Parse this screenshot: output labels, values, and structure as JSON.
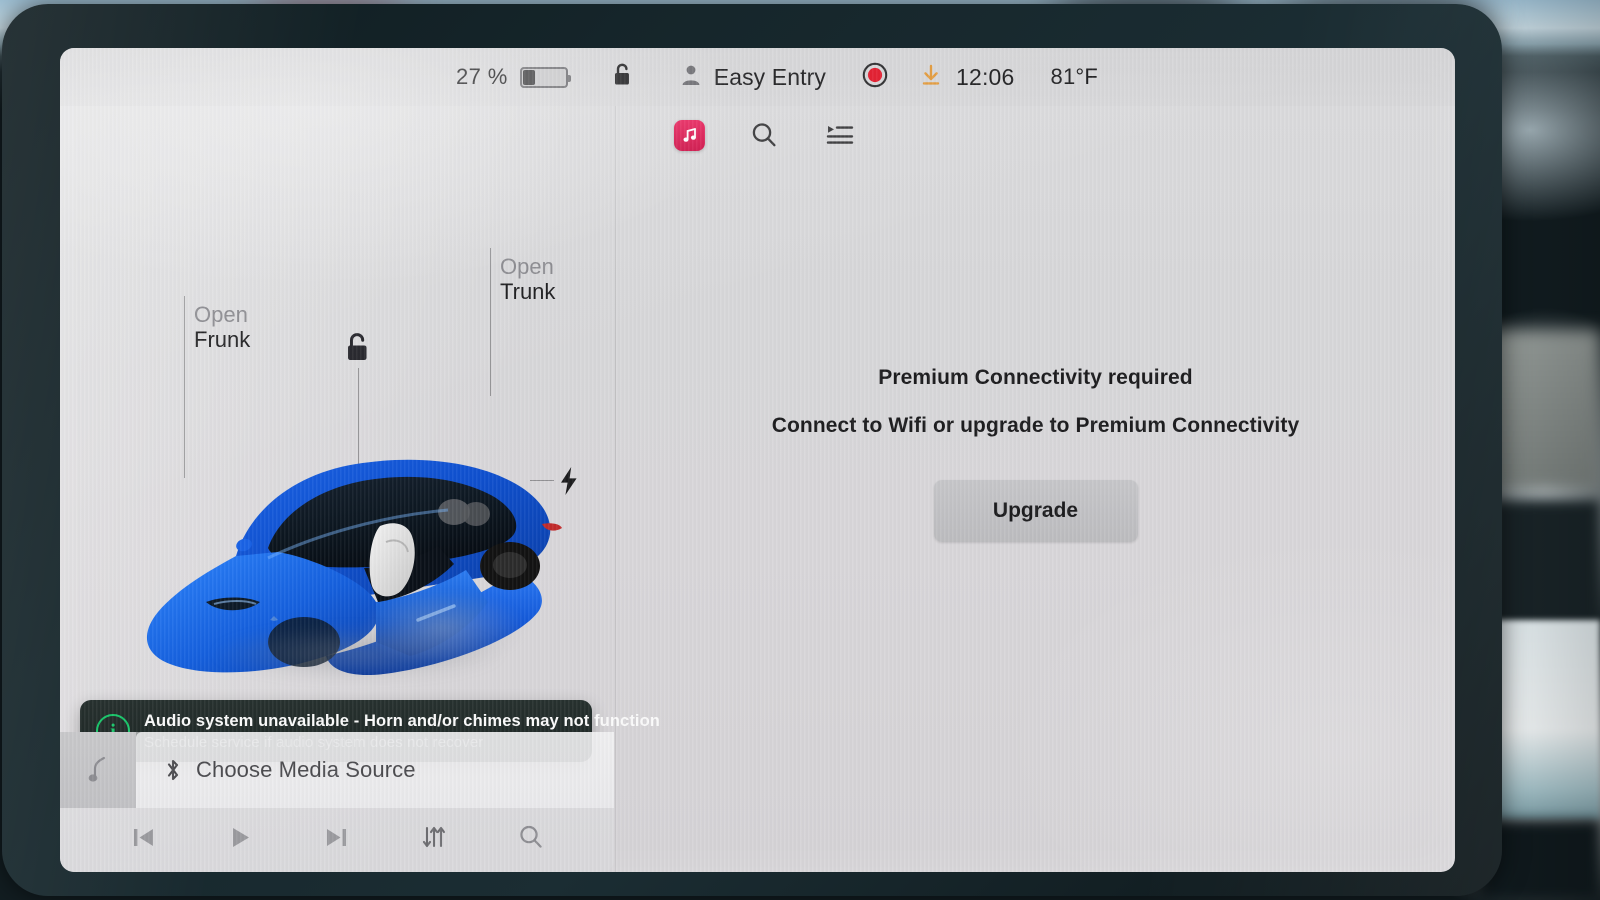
{
  "status_bar": {
    "battery_percent": "27 %",
    "battery_level": 27,
    "lock_icon": "unlocked-padlock-icon",
    "profile_icon": "person-icon",
    "profile_name": "Easy Entry",
    "record_icon": "dashcam-record-icon",
    "download_icon": "software-download-icon",
    "time": "12:06",
    "temperature": "81°F"
  },
  "car_panel": {
    "frunk": {
      "top": "Open",
      "bottom": "Frunk"
    },
    "trunk": {
      "top": "Open",
      "bottom": "Trunk"
    },
    "lock_icon": "unlocked-padlock-icon",
    "charge_port_icon": "lightning-bolt-icon",
    "vehicle_model": "Model 3",
    "vehicle_color": "#1358d8"
  },
  "notification": {
    "icon": "info-circle-icon",
    "icon_color": "#19c56a",
    "title": "Audio system unavailable - Horn and/or chimes may not function",
    "subtitle": "Schedule service if audio system does not recover"
  },
  "media_player": {
    "art_icon": "music-note-icon",
    "source_icon": "bluetooth-icon",
    "source_label": "Choose Media Source",
    "controls": [
      {
        "name": "previous-track-button",
        "icon": "skip-previous-icon"
      },
      {
        "name": "play-button",
        "icon": "play-icon"
      },
      {
        "name": "next-track-button",
        "icon": "skip-next-icon"
      },
      {
        "name": "tuner-button",
        "icon": "equalizer-sliders-icon"
      },
      {
        "name": "media-search-button",
        "icon": "search-icon"
      }
    ]
  },
  "media_app": {
    "tabs": [
      {
        "name": "tab-now-playing",
        "icon": "music-app-icon",
        "color": "#e9265f"
      },
      {
        "name": "tab-search",
        "icon": "search-icon"
      },
      {
        "name": "tab-queue",
        "icon": "playlist-queue-icon"
      }
    ],
    "empty_state": {
      "heading": "Premium Connectivity required",
      "message": "Connect to Wifi or upgrade to Premium Connectivity",
      "button_label": "Upgrade"
    }
  }
}
